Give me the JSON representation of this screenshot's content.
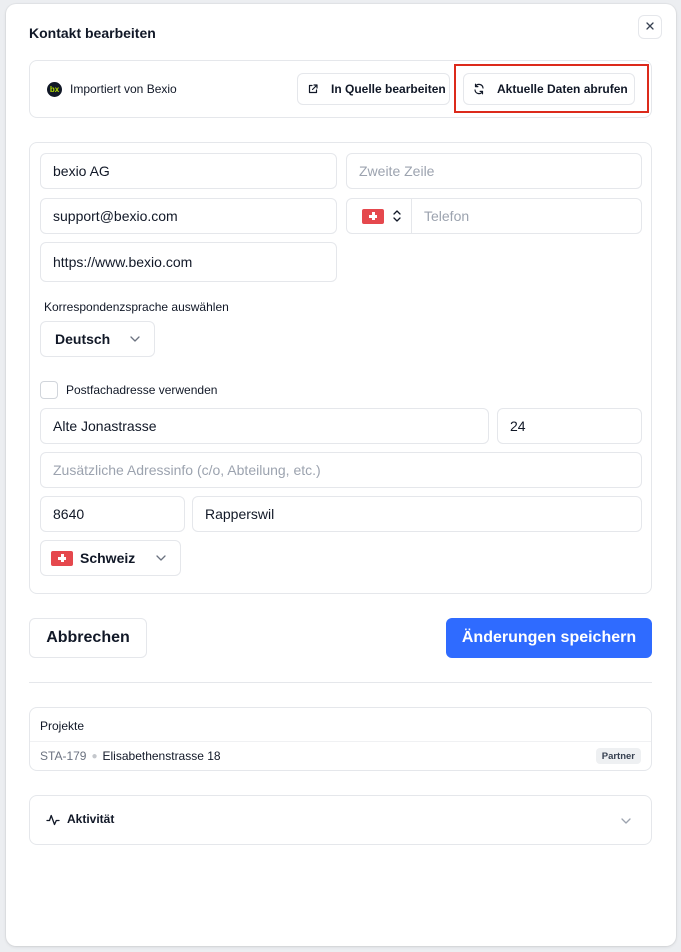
{
  "dialog": {
    "title": "Kontakt bearbeiten",
    "close_icon": "x-icon"
  },
  "source": {
    "logo_text": "bx",
    "label": "Importiert von Bexio",
    "edit_button": "In Quelle bearbeiten",
    "edit_icon": "external-link-icon",
    "refresh_button": "Aktuelle Daten abrufen",
    "refresh_icon": "refresh-icon",
    "highlight_color": "#dc2a1b"
  },
  "form": {
    "company": {
      "value": "bexio AG"
    },
    "second_line": {
      "placeholder": "Zweite Zeile"
    },
    "email": {
      "value": "support@bexio.com"
    },
    "phone": {
      "country_flag": "swiss-flag-icon",
      "placeholder": "Telefon"
    },
    "website": {
      "value": "https://www.bexio.com"
    },
    "language": {
      "label": "Korrespondenzsprache auswählen",
      "selected": "Deutsch"
    },
    "po_box": {
      "label": "Postfachadresse verwenden",
      "checked": false
    },
    "street": {
      "value": "Alte Jonastrasse"
    },
    "house_number": {
      "value": "24"
    },
    "additional": {
      "placeholder": "Zusätzliche Adressinfo (c/o, Abteilung, etc.)"
    },
    "zip": {
      "value": "8640"
    },
    "city": {
      "value": "Rapperswil"
    },
    "country": {
      "selected": "Schweiz",
      "flag": "swiss-flag-icon"
    }
  },
  "actions": {
    "cancel": "Abbrechen",
    "save": "Änderungen speichern",
    "primary_color": "#2f6bff"
  },
  "projects": {
    "title": "Projekte",
    "items": [
      {
        "code": "STA-179",
        "name": "Elisabethenstrasse 18",
        "badge": "Partner"
      }
    ]
  },
  "activity": {
    "label": "Aktivität",
    "icon": "activity-icon"
  }
}
